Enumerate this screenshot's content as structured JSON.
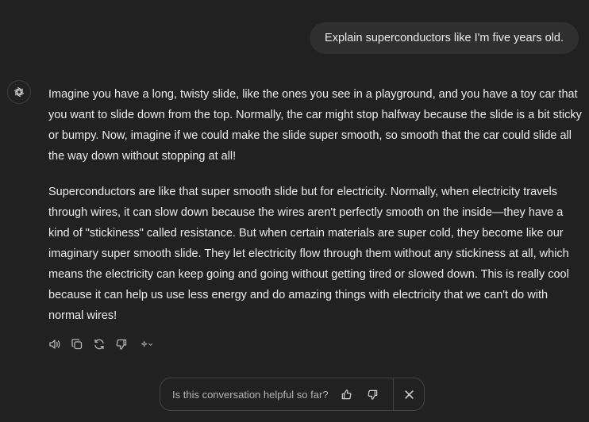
{
  "user_message": "Explain superconductors like I'm five years old.",
  "assistant": {
    "paragraphs": [
      "Imagine you have a long, twisty slide, like the ones you see in a playground, and you have a toy car that you want to slide down from the top. Normally, the car might stop halfway because the slide is a bit sticky or bumpy. Now, imagine if we could make the slide super smooth, so smooth that the car could slide all the way down without stopping at all!",
      "Superconductors are like that super smooth slide but for electricity. Normally, when electricity travels through wires, it can slow down because the wires aren't perfectly smooth on the inside—they have a kind of \"stickiness\" called resistance. But when certain materials are super cold, they become like our imaginary super smooth slide. They let electricity flow through them without any stickiness at all, which means the electricity can keep going and going without getting tired or slowed down. This is really cool because it can help us use less energy and do amazing things with electricity that we can't do with normal wires!"
    ],
    "actions": [
      "speaker-icon",
      "copy-icon",
      "regenerate-icon",
      "thumbs-down-icon",
      "sparkle-model-icon"
    ]
  },
  "feedback": {
    "question": "Is this conversation helpful so far?",
    "icons": [
      "thumbs-up-icon",
      "thumbs-down-icon",
      "close-icon"
    ]
  },
  "colors": {
    "background": "#212121",
    "bubble": "#2f2f2f",
    "text": "#ececec",
    "muted": "#b4b4b4",
    "border": "#424242"
  }
}
